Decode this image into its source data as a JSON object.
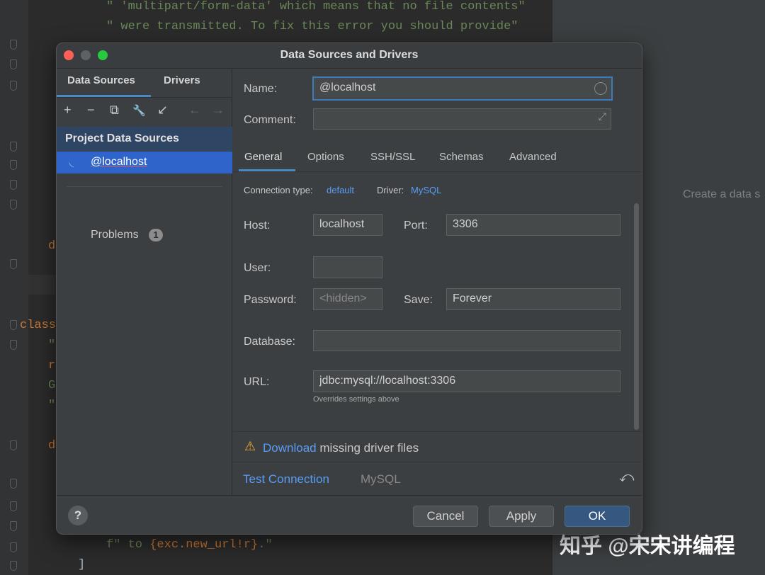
{
  "editor": {
    "line1": "\" 'multipart/form-data' which means that no file contents\"",
    "line2": "\" were transmitted. To fix this error you should provide\"",
    "line_d1": "d",
    "line_class": "class",
    "line_q1": "\"",
    "line_r": "r",
    "line_g": "G",
    "line_q2": "\"",
    "line_d2": "d",
    "line_f_prefix": "f\" to ",
    "line_f_expr": "{exc.new_url!r}",
    "line_f_suffix": ".\"",
    "line_bracket": "]"
  },
  "right_panel": {
    "hint": "Create a data s"
  },
  "watermark": "知乎 @宋宋讲编程",
  "dialog": {
    "title": "Data Sources and Drivers",
    "left_tabs": [
      "Data Sources",
      "Drivers"
    ],
    "toolbar_icons": [
      "add-icon",
      "remove-icon",
      "copy-icon",
      "wrench-icon",
      "import-icon",
      "back-arrow-icon",
      "forward-arrow-icon"
    ],
    "toolbar_glyphs": [
      "+",
      "−",
      "⧉",
      "🔧",
      "↙",
      "←",
      "→"
    ],
    "group_header": "Project Data Sources",
    "selected_source": "@localhost",
    "problems_label": "Problems",
    "problems_count": "1",
    "name_label": "Name:",
    "name_value": "@localhost",
    "comment_label": "Comment:",
    "comment_value": "",
    "tabs": [
      "General",
      "Options",
      "SSH/SSL",
      "Schemas",
      "Advanced"
    ],
    "active_tab": "General",
    "connection_type_label": "Connection type:",
    "connection_type_value": "default",
    "driver_label": "Driver:",
    "driver_value": "MySQL",
    "host_label": "Host:",
    "host_value": "localhost",
    "port_label": "Port:",
    "port_value": "3306",
    "user_label": "User:",
    "user_value": "",
    "password_label": "Password:",
    "password_placeholder": "<hidden>",
    "save_label": "Save:",
    "save_value": "Forever",
    "database_label": "Database:",
    "database_value": "",
    "url_label": "URL:",
    "url_value": "jdbc:mysql://localhost:3306",
    "url_hint": "Overrides settings above",
    "warning_link": "Download",
    "warning_text": " missing driver files",
    "test_connection": "Test Connection",
    "driver_tag": "MySQL",
    "help": "?",
    "cancel": "Cancel",
    "apply": "Apply",
    "ok": "OK"
  },
  "colors": {
    "accent": "#4a88c7",
    "selection": "#2f65ca",
    "link": "#589df6",
    "warning": "#f0a732",
    "primary_button": "#365880"
  }
}
